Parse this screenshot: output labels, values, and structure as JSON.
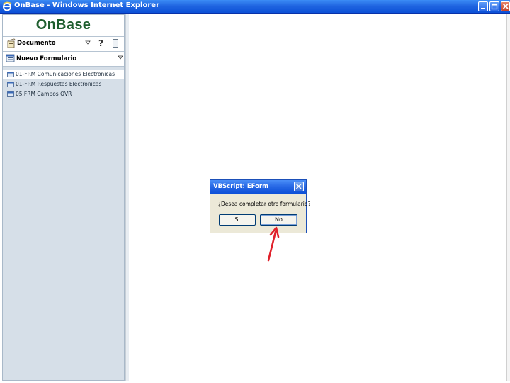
{
  "window": {
    "title": "OnBase - Windows Internet Explorer",
    "icon": "ie-icon"
  },
  "sidebar": {
    "logo": "OnBase",
    "document_selector": "Documento",
    "forms_selector": "Nuevo Formulario",
    "forms": [
      {
        "label": "01-FRM Comunicaciones Electronicas",
        "selected": true
      },
      {
        "label": "01-FRM Respuestas Electronicas",
        "selected": false
      },
      {
        "label": "05 FRM Campos QVR",
        "selected": false
      }
    ]
  },
  "dialog": {
    "title": "VBScript: EForm",
    "message": "¿Desea completar otro formulario?",
    "yes_label": "Si",
    "no_label": "No"
  },
  "colors": {
    "titlebar_blue": "#1f64e0",
    "logo_green": "#1e5e2e",
    "sidebar_bg": "#d6dfe8",
    "dialog_bg": "#ece9d8",
    "annotation_arrow": "#e0202a"
  }
}
